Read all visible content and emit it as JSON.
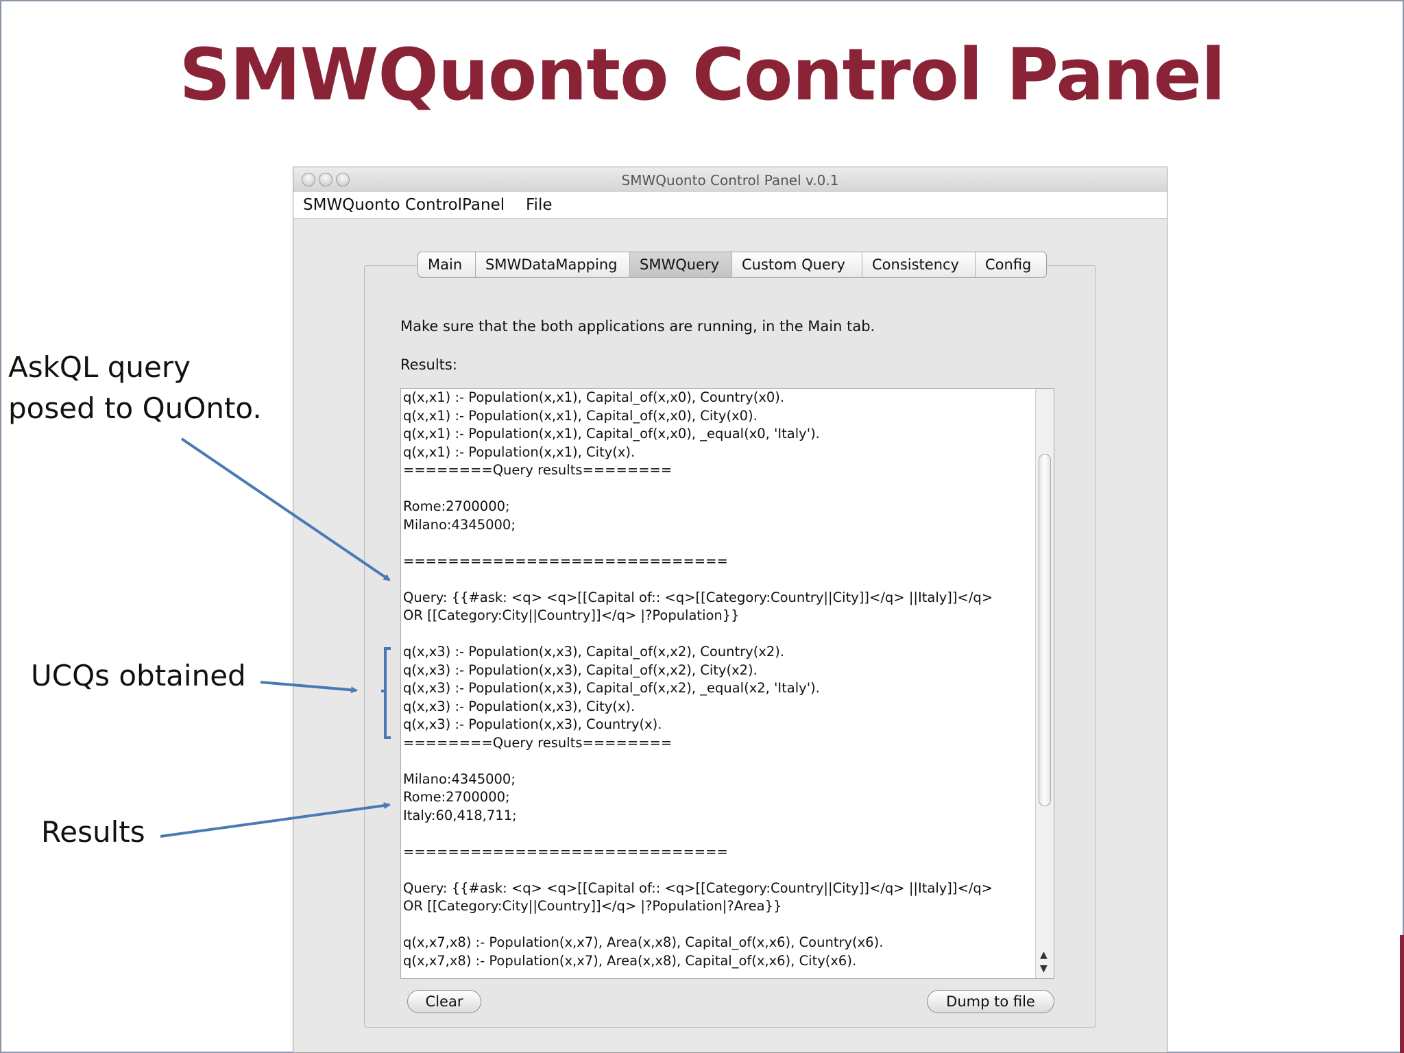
{
  "slide": {
    "title": "SMWQuonto Control Panel"
  },
  "window": {
    "title": "SMWQuonto Control Panel v.0.1",
    "menu": [
      "SMWQuonto ControlPanel",
      "File"
    ]
  },
  "tabs": [
    "Main",
    "SMWDataMapping",
    "SMWQuery",
    "Custom Query",
    "Consistency",
    "Config"
  ],
  "active_tab": "SMWQuery",
  "panel": {
    "info": "Make sure that the both applications are running, in the Main tab.",
    "results_label": "Results:",
    "results_lines": [
      "q(x,x1) :- Population(x,x1), Capital_of(x,x0), Country(x0).",
      "q(x,x1) :- Population(x,x1), Capital_of(x,x0), City(x0).",
      "q(x,x1) :- Population(x,x1), Capital_of(x,x0), _equal(x0, 'Italy').",
      "q(x,x1) :- Population(x,x1), City(x).",
      "========Query results========",
      "",
      "Rome:2700000;",
      "Milano:4345000;",
      "",
      "=============================",
      "",
      "Query: {{#ask: <q> <q>[[Capital of:: <q>[[Category:Country||City]]</q> ||Italy]]</q>",
      "OR [[Category:City||Country]]</q> |?Population}}",
      "",
      "q(x,x3) :- Population(x,x3), Capital_of(x,x2), Country(x2).",
      "q(x,x3) :- Population(x,x3), Capital_of(x,x2), City(x2).",
      "q(x,x3) :- Population(x,x3), Capital_of(x,x2), _equal(x2, 'Italy').",
      "q(x,x3) :- Population(x,x3), City(x).",
      "q(x,x3) :- Population(x,x3), Country(x).",
      "========Query results========",
      "",
      "Milano:4345000;",
      "Rome:2700000;",
      "Italy:60,418,711;",
      "",
      "=============================",
      "",
      "Query: {{#ask: <q> <q>[[Capital of:: <q>[[Category:Country||City]]</q> ||Italy]]</q>",
      "OR [[Category:City||Country]]</q> |?Population|?Area}}",
      "",
      "q(x,x7,x8) :- Population(x,x7), Area(x,x8), Capital_of(x,x6), Country(x6).",
      "q(x,x7,x8) :- Population(x,x7), Area(x,x8), Capital_of(x,x6), City(x6)."
    ]
  },
  "buttons": {
    "clear": "Clear",
    "dump": "Dump to file"
  },
  "annotations": {
    "askql_line1": "AskQL query",
    "askql_line2": "posed to QuOnto.",
    "ucqs": "UCQs obtained",
    "results": "Results"
  },
  "colors": {
    "title": "#8a2335",
    "arrow": "#4a7ab5"
  }
}
